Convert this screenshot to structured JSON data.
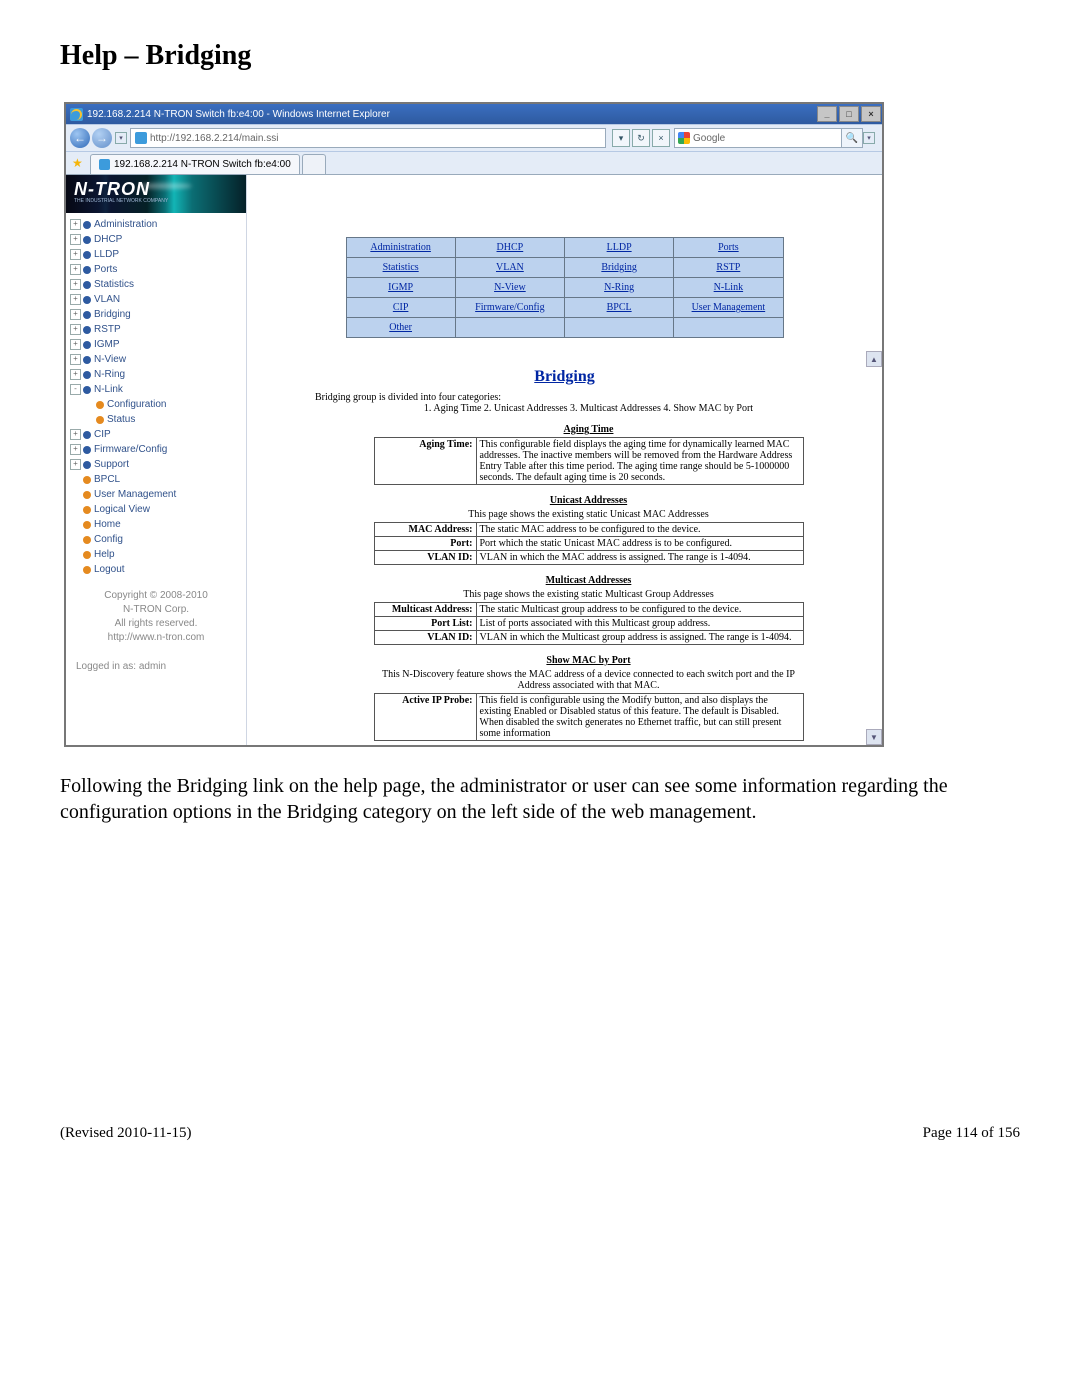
{
  "doc": {
    "title": "Help – Bridging",
    "paragraph": "Following the Bridging link on the help page, the administrator or user can see some information regarding the configuration options in the Bridging category on the left side of the web management.",
    "revised": "(Revised 2010-11-15)",
    "page": "Page 114 of 156"
  },
  "browser": {
    "windowTitle": "192.168.2.214 N-TRON Switch fb:e4:00 - Windows Internet Explorer",
    "url": "http://192.168.2.214/main.ssi",
    "searchEngine": "Google",
    "tabTitle": "192.168.2.214 N-TRON Switch fb:e4:00",
    "win": {
      "min": "_",
      "max": "□",
      "close": "×"
    }
  },
  "logo": {
    "brand": "N-TRON",
    "sub": "THE INDUSTRIAL NETWORK COMPANY"
  },
  "nav": [
    {
      "exp": "+",
      "dot": "blue",
      "label": "Administration"
    },
    {
      "exp": "+",
      "dot": "blue",
      "label": "DHCP"
    },
    {
      "exp": "+",
      "dot": "blue",
      "label": "LLDP"
    },
    {
      "exp": "+",
      "dot": "blue",
      "label": "Ports"
    },
    {
      "exp": "+",
      "dot": "blue",
      "label": "Statistics"
    },
    {
      "exp": "+",
      "dot": "blue",
      "label": "VLAN"
    },
    {
      "exp": "+",
      "dot": "blue",
      "label": "Bridging"
    },
    {
      "exp": "+",
      "dot": "blue",
      "label": "RSTP"
    },
    {
      "exp": "+",
      "dot": "blue",
      "label": "IGMP"
    },
    {
      "exp": "+",
      "dot": "blue",
      "label": "N-View"
    },
    {
      "exp": "+",
      "dot": "blue",
      "label": "N-Ring"
    },
    {
      "exp": "-",
      "dot": "blue",
      "label": "N-Link"
    },
    {
      "indent": 2,
      "dot": "orange",
      "label": "Configuration"
    },
    {
      "indent": 2,
      "dot": "orange",
      "label": "Status"
    },
    {
      "exp": "+",
      "dot": "blue",
      "label": "CIP"
    },
    {
      "exp": "+",
      "dot": "blue",
      "label": "Firmware/Config"
    },
    {
      "exp": "+",
      "dot": "blue",
      "label": "Support"
    },
    {
      "indent": 1,
      "dot": "orange",
      "label": "BPCL"
    },
    {
      "indent": 1,
      "dot": "orange",
      "label": "User Management"
    },
    {
      "indent": 1,
      "dot": "orange",
      "label": "Logical View"
    },
    {
      "indent": 1,
      "dot": "orange",
      "label": "Home"
    },
    {
      "indent": 1,
      "dot": "orange",
      "label": "Config"
    },
    {
      "indent": 1,
      "dot": "orange",
      "label": "Help"
    },
    {
      "indent": 1,
      "dot": "orange",
      "label": "Logout"
    }
  ],
  "sideFooter": {
    "copyright": "Copyright © 2008-2010",
    "corp": "N-TRON Corp.",
    "rights": "All rights reserved.",
    "url": "http://www.n-tron.com",
    "login": "Logged in as: admin"
  },
  "grid": [
    [
      "Administration",
      "DHCP",
      "LLDP",
      "Ports"
    ],
    [
      "Statistics",
      "VLAN",
      "Bridging",
      "RSTP"
    ],
    [
      "IGMP",
      "N-View",
      "N-Ring",
      "N-Link"
    ],
    [
      "CIP",
      "Firmware/Config",
      "BPCL",
      "User Management"
    ],
    [
      "Other",
      "",
      "",
      ""
    ]
  ],
  "help": {
    "title": "Bridging",
    "introA": "Bridging group is divided into four categories:",
    "introB": "1. Aging Time   2. Unicast Addresses   3. Multicast Addresses   4. Show MAC by Port",
    "sections": {
      "aging": {
        "head": "Aging Time",
        "rows": [
          {
            "k": "Aging Time:",
            "v": "This configurable field displays the aging time for dynamically learned MAC addresses. The inactive members will be removed from the Hardware Address Entry Table after this time period. The aging time range should be 5-1000000 seconds. The default aging time is 20 seconds."
          }
        ]
      },
      "unicast": {
        "head": "Unicast Addresses",
        "note": "This page shows the existing static Unicast MAC Addresses",
        "rows": [
          {
            "k": "MAC Address:",
            "v": "The static MAC address to be configured to the device."
          },
          {
            "k": "Port:",
            "v": "Port which the static Unicast MAC address is to be configured."
          },
          {
            "k": "VLAN ID:",
            "v": "VLAN in which the MAC address is assigned. The range is 1-4094."
          }
        ]
      },
      "multicast": {
        "head": "Multicast Addresses",
        "note": "This page shows the existing static Multicast Group Addresses",
        "rows": [
          {
            "k": "Multicast Address:",
            "v": "The static Multicast group address to be configured to the device."
          },
          {
            "k": "Port List:",
            "v": "List of ports associated with this Multicast group address."
          },
          {
            "k": "VLAN ID:",
            "v": "VLAN in which the Multicast group address is assigned. The range is 1-4094."
          }
        ]
      },
      "mac": {
        "head": "Show MAC by Port",
        "note": "This N-Discovery feature shows the MAC address of a device connected to each switch port and the IP Address associated with that MAC.",
        "rows": [
          {
            "k": "Active IP Probe:",
            "v": "This field is configurable using the Modify button, and also displays the existing Enabled or Disabled status of this feature. The default is Disabled. When disabled the switch generates no Ethernet traffic, but can still present some information"
          }
        ]
      }
    }
  }
}
